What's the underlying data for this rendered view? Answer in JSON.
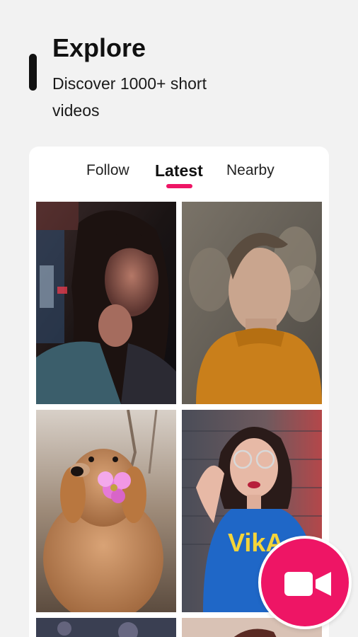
{
  "header": {
    "title": "Explore",
    "subtitle": "Discover 1000+ short videos"
  },
  "tabs": [
    {
      "label": "Follow",
      "active": false
    },
    {
      "label": "Latest",
      "active": true
    },
    {
      "label": "Nearby",
      "active": false
    }
  ],
  "feed": {
    "items": [
      {
        "subject": "woman with finger on lips, neon lights"
      },
      {
        "subject": "man in orange turtleneck, double exposure"
      },
      {
        "subject": "golden retriever holding pink flower"
      },
      {
        "subject": "woman with round glasses, blue shirt"
      },
      {
        "subject": "partially visible video"
      },
      {
        "subject": "partially visible video"
      }
    ]
  },
  "colors": {
    "accent": "#ee1565",
    "background": "#f2f2f2",
    "card": "#ffffff",
    "text": "#111111"
  },
  "icons": {
    "record": "video-camera-icon"
  }
}
